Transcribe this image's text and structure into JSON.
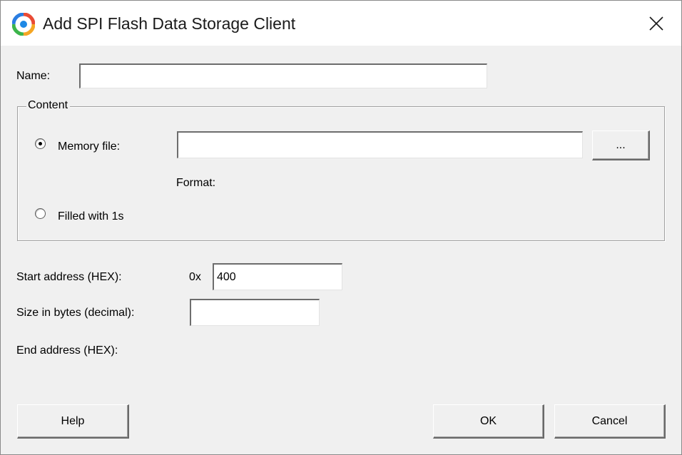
{
  "window": {
    "title": "Add SPI Flash Data Storage Client",
    "icon": "app-logo-icon",
    "close_icon": "close-icon"
  },
  "form": {
    "name_label": "Name:",
    "name_value": "",
    "content": {
      "group_label": "Content",
      "memory_file_label": "Memory file:",
      "memory_file_selected": true,
      "memory_file_value": "",
      "browse_label": "...",
      "format_label": "Format:",
      "filled_label": "Filled with 1s",
      "filled_selected": false
    },
    "start_address_label": "Start address (HEX):",
    "start_address_prefix": "0x",
    "start_address_value": "400",
    "size_label": "Size in bytes (decimal):",
    "size_value": "",
    "end_address_label": "End address (HEX):"
  },
  "buttons": {
    "help": "Help",
    "ok": "OK",
    "cancel": "Cancel"
  }
}
